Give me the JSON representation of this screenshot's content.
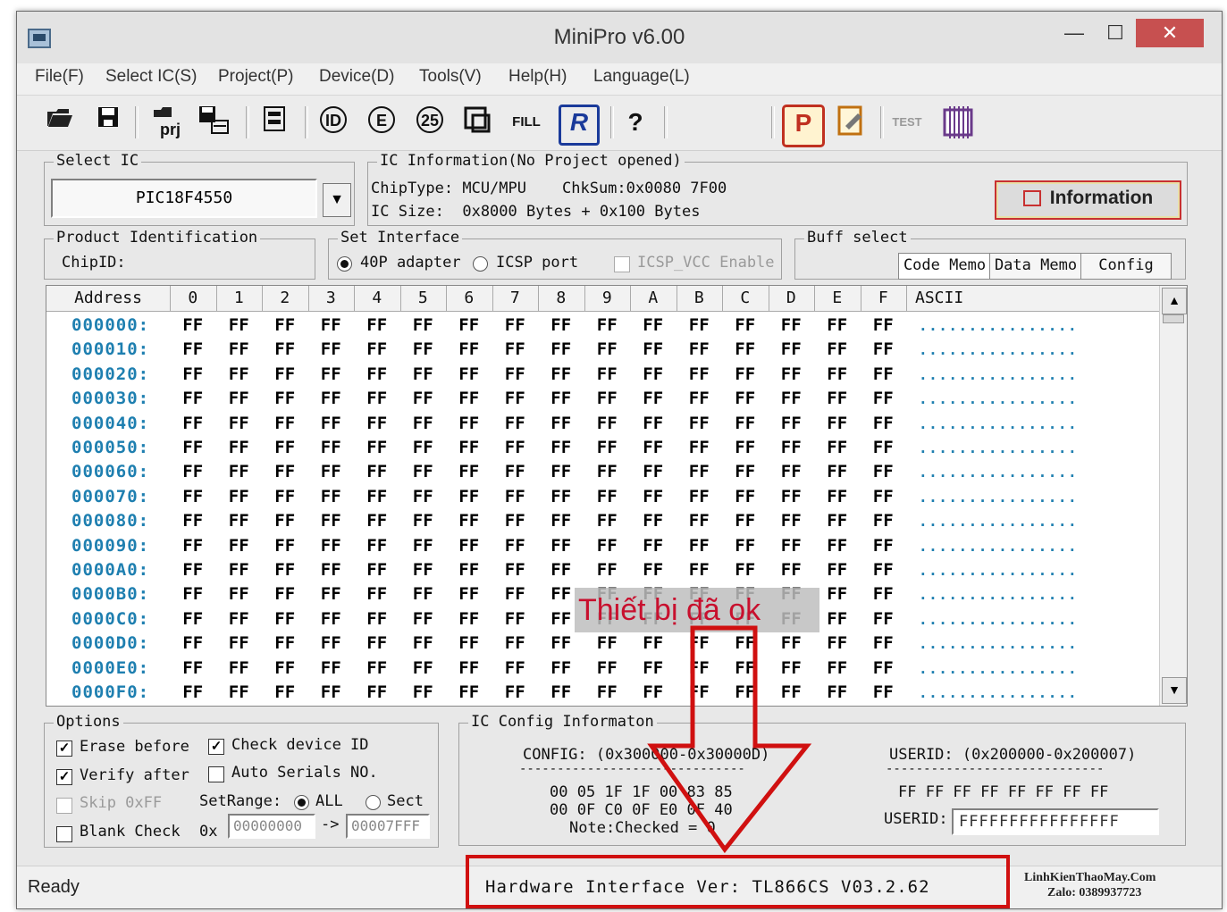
{
  "window": {
    "title": "MiniPro v6.00",
    "controls": {
      "minimize": "—",
      "maximize": "☐",
      "close": "✕"
    }
  },
  "menu": [
    "File(F)",
    "Select IC(S)",
    "Project(P)",
    "Device(D)",
    "Tools(V)",
    "Help(H)",
    "Language(L)"
  ],
  "toolbar": {
    "open_icon": "folder-open-icon",
    "save_icon": "save-icon",
    "prj_label": "prj",
    "fill_label": "FILL",
    "r_label": "R",
    "help_label": "?",
    "p_label": "P",
    "test_label": "TEST"
  },
  "select_ic": {
    "label": "Select IC",
    "value": "PIC18F4550"
  },
  "ic_info": {
    "label": "IC Information(No Project opened)",
    "chiptype": "ChipType: MCU/MPU",
    "chksum": "ChkSum:0x0080 7F00",
    "icsize": "IC Size:  0x8000 Bytes + 0x100 Bytes",
    "info_button": "Information"
  },
  "product_id": {
    "label": "Product Identification",
    "chipid": "ChipID:"
  },
  "interface": {
    "label": "Set Interface",
    "opt1": "40P adapter",
    "opt2": "ICSP port",
    "icsp_vcc": "ICSP_VCC Enable"
  },
  "buff_select": {
    "label": "Buff select",
    "tabs": [
      "Code Memo",
      "Data Memo",
      "Config"
    ]
  },
  "hex_grid": {
    "address_header": "Address",
    "columns": [
      "0",
      "1",
      "2",
      "3",
      "4",
      "5",
      "6",
      "7",
      "8",
      "9",
      "A",
      "B",
      "C",
      "D",
      "E",
      "F"
    ],
    "ascii_header": "ASCII",
    "rows": [
      {
        "addr": "000000:",
        "ascii": "................"
      },
      {
        "addr": "000010:",
        "ascii": "................"
      },
      {
        "addr": "000020:",
        "ascii": "................"
      },
      {
        "addr": "000030:",
        "ascii": "................"
      },
      {
        "addr": "000040:",
        "ascii": "................"
      },
      {
        "addr": "000050:",
        "ascii": "................"
      },
      {
        "addr": "000060:",
        "ascii": "................"
      },
      {
        "addr": "000070:",
        "ascii": "................"
      },
      {
        "addr": "000080:",
        "ascii": "................"
      },
      {
        "addr": "000090:",
        "ascii": "................"
      },
      {
        "addr": "0000A0:",
        "ascii": "................"
      },
      {
        "addr": "0000B0:",
        "ascii": "................"
      },
      {
        "addr": "0000C0:",
        "ascii": "................"
      },
      {
        "addr": "0000D0:",
        "ascii": "................"
      },
      {
        "addr": "0000E0:",
        "ascii": "................"
      },
      {
        "addr": "0000F0:",
        "ascii": "................"
      }
    ],
    "cell_value": "FF"
  },
  "options": {
    "label": "Options",
    "erase_before": "Erase before",
    "check_device_id": "Check device ID",
    "verify_after": "Verify after",
    "auto_serials": "Auto Serials NO.",
    "skip_0xff": "Skip 0xFF",
    "setrange": "SetRange:",
    "all": "ALL",
    "sect": "Sect",
    "blank_check": "Blank Check",
    "ox": "0x",
    "range_start": "00000000",
    "arrow": "->",
    "range_end": "00007FFF"
  },
  "ic_config": {
    "label": "IC Config Informaton",
    "config_title": "CONFIG: (0x300000-0x30000D)",
    "dashes": "------------------------------",
    "line1": "00 05 1F 1F 00 83 85",
    "line2": "00 0F C0 0F E0 0F 40",
    "note": "Note:Checked = 0",
    "userid_title": "USERID: (0x200000-0x200007)",
    "userid_dashes": "-----------------------------",
    "userid_values": "FF FF FF FF FF FF FF FF",
    "userid_label": "USERID:",
    "userid_input": "FFFFFFFFFFFFFFFF"
  },
  "status": {
    "ready": "Ready",
    "hardware": "Hardware Interface Ver: TL866CS V03.2.62"
  },
  "annotation": {
    "overlay_text": "Thiết bị đã ok"
  },
  "watermark": {
    "line1": "LinhKienThaoMay.Com",
    "line2": "Zalo: 0389937723"
  },
  "colors": {
    "address": "#1e7fb0",
    "highlight": "#d01010"
  }
}
